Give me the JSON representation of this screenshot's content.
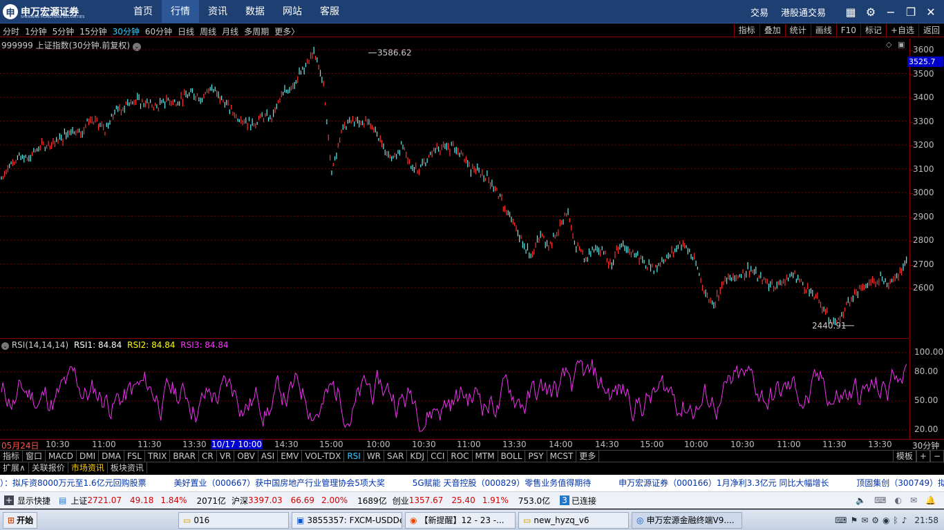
{
  "app": {
    "logo_text": "申万宏源证券",
    "logo_sub": "SHENWAN HONGYUAN SECURITIES",
    "nav": [
      "首页",
      "行情",
      "资讯",
      "数据",
      "网站",
      "客服"
    ],
    "nav_active": 1,
    "right_links": [
      "交易",
      "港股通交易"
    ]
  },
  "periods": {
    "items": [
      "分时",
      "1分钟",
      "5分钟",
      "15分钟",
      "30分钟",
      "60分钟",
      "日线",
      "周线",
      "月线",
      "多周期",
      "更多〉"
    ],
    "active": 4
  },
  "toolbar": [
    "指标",
    "叠加",
    "统计",
    "画线",
    "F10",
    "标记",
    "+自选",
    "返回"
  ],
  "chart_title": "999999 上证指数(30分钟.前复权)",
  "price_axis": {
    "ticks": [
      "3600",
      "3500",
      "3400",
      "3300",
      "3200",
      "3100",
      "3000",
      "2900",
      "2800",
      "2700",
      "2600"
    ],
    "current": "3525.7"
  },
  "annotations": {
    "high": "3586.62",
    "low": "2440.91"
  },
  "rsi": {
    "name": "RSI(14,14,14)",
    "rsi1": "RSI1: 84.84",
    "rsi2": "RSI2: 84.84",
    "rsi3": "RSI3: 84.84",
    "ticks": [
      "100.00",
      "80.00",
      "50.00",
      "20.00"
    ]
  },
  "time_axis": {
    "labels": [
      "05月24日",
      "10:30",
      "11:00",
      "11:30",
      "13:30",
      "10/17 10:00",
      "14:30",
      "15:00",
      "10:00",
      "10:30",
      "11:00",
      "13:30",
      "14:00",
      "14:30",
      "15:00",
      "10:00",
      "10:30",
      "11:00",
      "11:30",
      "13:30"
    ],
    "period": "30分钟"
  },
  "indicator_tabs": {
    "items": [
      "指标",
      "窗口",
      "MACD",
      "DMI",
      "DMA",
      "FSL",
      "TRIX",
      "BRAR",
      "CR",
      "VR",
      "OBV",
      "ASI",
      "EMV",
      "VOL-TDX",
      "RSI",
      "WR",
      "SAR",
      "KDJ",
      "CCI",
      "ROC",
      "MTM",
      "BOLL",
      "PSY",
      "MCST",
      "更多"
    ],
    "active": 14,
    "right": [
      "模板",
      "+",
      "−"
    ]
  },
  "ext_tabs": {
    "items": [
      "扩展∧",
      "关联报价",
      "市场资讯",
      "板块资讯"
    ],
    "active": 2
  },
  "news": [
    "）：拟斥资8000万元至1.6亿元回购股票",
    "美好置业（000667）获中国房地产行业管理协会5项大奖",
    "5G赋能 天音控股（000829）零售业务值得期待",
    "申万宏源证券（000166）1月净利3.3亿元 同比大幅增长",
    "顶固集创（300749）拟7亿元收"
  ],
  "status": {
    "shortcut": "显示快捷",
    "sh_label": "上证",
    "sh_val": "2721.07",
    "sh_chg": "49.18",
    "sh_pct": "1.84%",
    "sh_amt": "2071亿",
    "hs_label": "沪深",
    "hs_val": "3397.03",
    "hs_chg": "66.69",
    "hs_pct": "2.00%",
    "hs_amt": "1689亿",
    "cy_label": "创业",
    "cy_val": "1357.67",
    "cy_chg": "25.40",
    "cy_pct": "1.91%",
    "cy_amt": "753.0亿",
    "conn_num": "3",
    "conn": "已连接"
  },
  "taskbar": {
    "start": "开始",
    "items": [
      "016",
      "3855357: FXCM-USDDe...",
      "【新提醒】12 - 23 -...",
      "new_hyzq_v6",
      "申万宏源金融终端V9...."
    ],
    "clock": "21:58"
  },
  "chart_data": {
    "type": "line",
    "title": "999999 上证指数(30分钟.前复权)",
    "price_range": [
      2400,
      3650
    ],
    "price_high": 3586.62,
    "price_low": 2440.91,
    "price_path": [
      3060,
      3120,
      3150,
      3140,
      3180,
      3200,
      3210,
      3230,
      3270,
      3250,
      3300,
      3290,
      3260,
      3340,
      3360,
      3390,
      3380,
      3370,
      3360,
      3390,
      3380,
      3400,
      3420,
      3400,
      3440,
      3410,
      3360,
      3320,
      3300,
      3290,
      3320,
      3310,
      3390,
      3440,
      3480,
      3530,
      3586.62,
      3450,
      3080,
      3260,
      3300,
      3290,
      3300,
      3260,
      3180,
      3140,
      3200,
      3110,
      3100,
      3140,
      3190,
      3180,
      3200,
      3150,
      3100,
      3080,
      3060,
      3000,
      2920,
      2860,
      2780,
      2740,
      2820,
      2780,
      2840,
      2920,
      2780,
      2720,
      2760,
      2770,
      2700,
      2770,
      2760,
      2740,
      2700,
      2680,
      2720,
      2740,
      2790,
      2760,
      2680,
      2560,
      2540,
      2630,
      2640,
      2660,
      2680,
      2640,
      2620,
      2610,
      2630,
      2660,
      2620,
      2580,
      2540,
      2480,
      2440.91,
      2520,
      2580,
      2600,
      2620,
      2650,
      2610,
      2660,
      2720
    ],
    "rsi_range": [
      0,
      100
    ],
    "rsi_current": 84.84
  }
}
